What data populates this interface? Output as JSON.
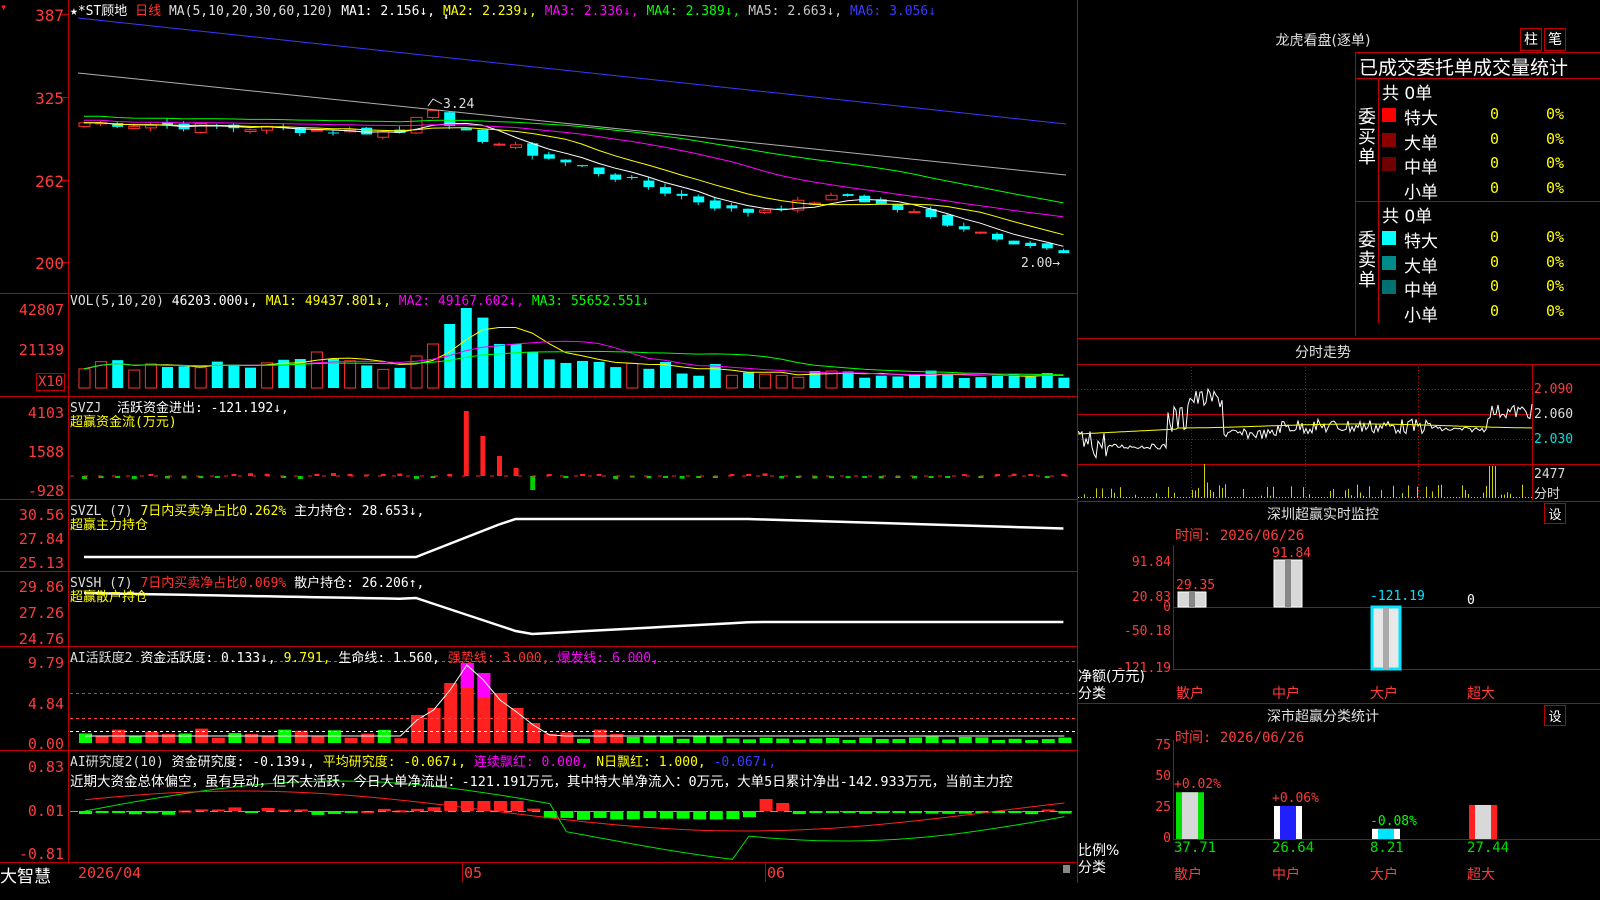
{
  "main": {
    "stock_name": "★*ST顾地",
    "period": "日线",
    "ma_label": "MA(5,10,20,30,60,120)",
    "ma": [
      {
        "name": "MA1:",
        "value": "2.156↓",
        "color": "#ffffff"
      },
      {
        "name": "MA2:",
        "value": "2.239↓",
        "color": "#ffff00"
      },
      {
        "name": "MA3:",
        "value": "2.336↓",
        "color": "#ff00ff"
      },
      {
        "name": "MA4:",
        "value": "2.389↓",
        "color": "#00ff00"
      },
      {
        "name": "MA5:",
        "value": "2.663↓",
        "color": "#c8c8c8"
      },
      {
        "name": "MA6:",
        "value": "3.056↓",
        "color": "#3a3aff"
      }
    ],
    "y_labels": [
      "387",
      "325",
      "262",
      "200"
    ],
    "high_marker": "3.24",
    "low_marker": "2.00→"
  },
  "vol": {
    "label": "VOL(5,10,20)",
    "value": "46203.000↓",
    "ma1": "MA1: 49437.801↓",
    "ma2": "MA2: 49167.602↓",
    "ma3": "MA3: 55652.551↓",
    "y_labels": [
      "42807",
      "21139"
    ],
    "unit": "X10"
  },
  "svzj": {
    "title": "SVZJ",
    "text": "活跃资金进出: -121.192↓,",
    "sub": "超赢资金流(万元)",
    "y_labels": [
      "4103",
      "1588",
      "-928"
    ]
  },
  "svzl": {
    "title": "SVZL (7)",
    "ratio": "7日内买卖净占比0.262%",
    "hold": "主力持仓: 28.653↓,",
    "sub": "超赢主力持仓",
    "y_labels": [
      "30.56",
      "27.84",
      "25.13"
    ]
  },
  "svsh": {
    "title": "SVSH (7)",
    "ratio": "7日内买卖净占比0.069%",
    "hold": "散户持仓: 26.206↑,",
    "sub": "超赢散户持仓",
    "y_labels": [
      "29.86",
      "27.26",
      "24.76"
    ]
  },
  "ai_active": {
    "title": "AI活跃度2",
    "t1": "资金活跃度: 0.133↓,",
    "t2": "9.791,",
    "t3": "生命线: 1.560,",
    "t4": "强势线: 3.000,",
    "t5": "爆发线: 6.000,",
    "y_labels": [
      "9.79",
      "4.84",
      "0.00"
    ]
  },
  "ai_research": {
    "title": "AI研究度2(10)",
    "t1": "资金研究度: -0.139↓,",
    "t2": "平均研究度: -0.067↓,",
    "t3": "连续飘红: 0.000,",
    "t4": "N日飘红: 1.000,",
    "t5": "-0.067↓,",
    "commentary": "近期大资金总体偏空，虽有异动，但不太活跃，今日大单净流出：-121.191万元，其中特大单净流入：0万元，大单5日累计净出-142.933万元，当前主力控",
    "y_labels": [
      "0.83",
      "0.01",
      "-0.81"
    ]
  },
  "bottom_bar": {
    "brand": "大智慧",
    "dates": [
      "2026/04",
      "05",
      "06"
    ]
  },
  "longhu": {
    "title": "龙虎看盘(逐单)",
    "btn1": "柱",
    "btn2": "笔",
    "stats_header": "已成交委托单成交量统计",
    "buy_label": "委买单",
    "sell_label": "委卖单",
    "buy_total": "共 0单",
    "sell_total": "共 0单",
    "buy_rows": [
      {
        "name": "特大",
        "count": "0",
        "pct": "0%",
        "color": "#ff0000"
      },
      {
        "name": "大单",
        "count": "0",
        "pct": "0%",
        "color": "#8b0000"
      },
      {
        "name": "中单",
        "count": "0",
        "pct": "0%",
        "color": "#6e0000"
      },
      {
        "name": "小单",
        "count": "0",
        "pct": "0%",
        "color": ""
      }
    ],
    "sell_rows": [
      {
        "name": "特大",
        "count": "0",
        "pct": "0%",
        "color": "#00ffff"
      },
      {
        "name": "大单",
        "count": "0",
        "pct": "0%",
        "color": "#008b8b"
      },
      {
        "name": "中单",
        "count": "0",
        "pct": "0%",
        "color": "#007070"
      },
      {
        "name": "小单",
        "count": "0",
        "pct": "0%",
        "color": ""
      }
    ]
  },
  "fenshi": {
    "title": "分时走势",
    "y_labels": [
      "2.090",
      "2.060",
      "2.030"
    ],
    "vol_label": "2477",
    "vol_sub": "分时"
  },
  "monitor": {
    "title": "深圳超赢实时监控",
    "set": "设",
    "time": "时间: 2026/06/26",
    "y_labels": [
      "91.84",
      "20.83",
      "0",
      "-50.18",
      "-121.19"
    ],
    "bars": [
      {
        "cat": "散户",
        "value": 29.35,
        "label": "29.35"
      },
      {
        "cat": "中户",
        "value": 91.84,
        "label": "91.84"
      },
      {
        "cat": "大户",
        "value": -121.19,
        "label": "-121.19"
      },
      {
        "cat": "超大",
        "value": 0,
        "label": "0"
      }
    ],
    "unit": "净额(万元)",
    "cls": "分类"
  },
  "classify": {
    "title": "深市超赢分类统计",
    "set": "设",
    "time": "时间: 2026/06/26",
    "y_labels": [
      "75",
      "50",
      "25",
      "0"
    ],
    "bars": [
      {
        "cat": "散户",
        "pct": 37.71,
        "change": "+0.02%",
        "value": "37.71"
      },
      {
        "cat": "中户",
        "pct": 26.64,
        "change": "+0.06%",
        "value": "26.64"
      },
      {
        "cat": "大户",
        "pct": 8.21,
        "change": "-0.08%",
        "value": "8.21"
      },
      {
        "cat": "超大",
        "pct": 27.44,
        "change": "",
        "value": "27.44"
      }
    ],
    "unit": "比例%",
    "cls": "分类"
  },
  "chart_data": {
    "type": "candlestick",
    "title": "★*ST顾地 日线",
    "x_labels": [
      "2026/04",
      "05",
      "06"
    ],
    "ylim": [
      2.0,
      3.87
    ],
    "close_first": 3.05,
    "close_last": 2.0,
    "high": 3.24,
    "low": 2.0
  }
}
